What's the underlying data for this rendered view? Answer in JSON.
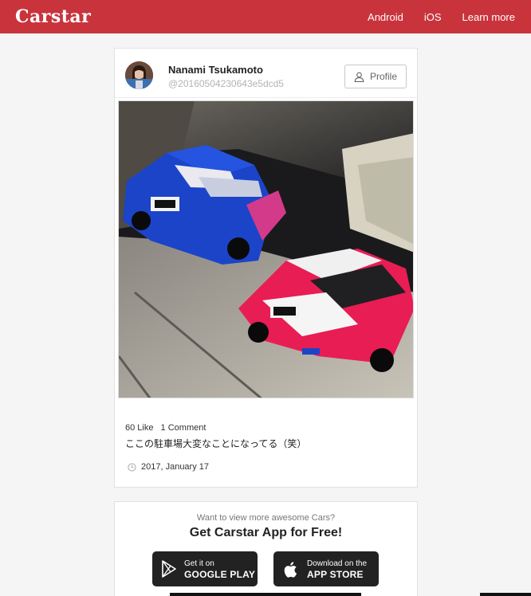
{
  "nav": {
    "logo": "Carstar",
    "links": [
      "Android",
      "iOS",
      "Learn more"
    ]
  },
  "post": {
    "user_name": "Nanami Tsukamoto",
    "user_id": "@20160504230643e5dcd5",
    "profile_label": "Profile",
    "likes": "60 Like",
    "comments": "1 Comment",
    "caption": "ここの駐車場大変なことになってる（笑）",
    "date": "2017, January 17",
    "photo_alt": "two itasha drift cars in a parking garage"
  },
  "promo": {
    "subtitle": "Want to view more awesome Cars?",
    "title": "Get Carstar App for Free!",
    "google_small": "Get it on",
    "google_big": "GOOGLE PLAY",
    "apple_small": "Download on the",
    "apple_big": "APP STORE"
  },
  "colors": {
    "brand": "#c9343c",
    "background": "#f5f5f5",
    "store_button": "#222222"
  }
}
